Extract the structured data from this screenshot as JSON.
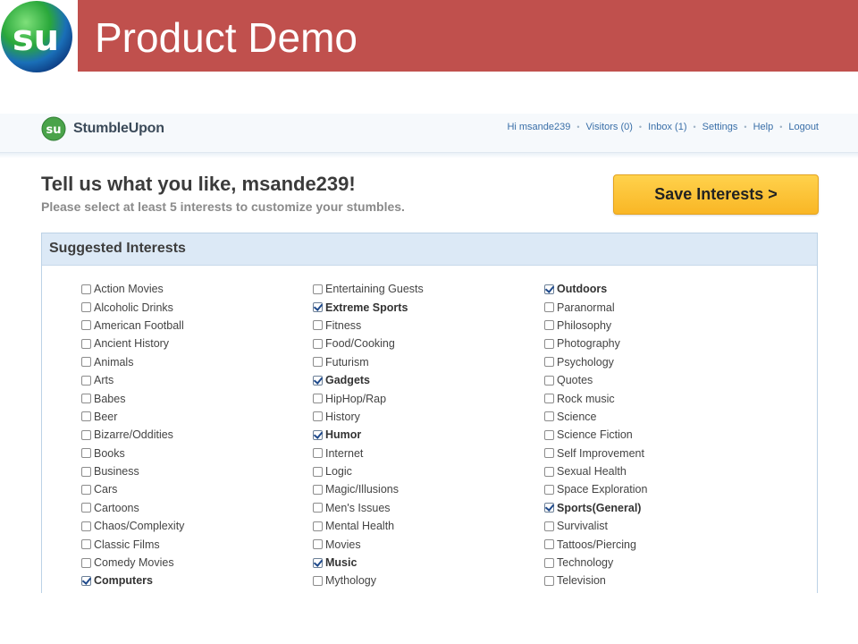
{
  "slide": {
    "title": "Product Demo"
  },
  "app": {
    "name": "StumbleUpon",
    "nav": [
      "Hi msande239",
      "Visitors (0)",
      "Inbox (1)",
      "Settings",
      "Help",
      "Logout"
    ]
  },
  "main": {
    "heading": "Tell us what you like, msande239!",
    "subheading": "Please select at least 5 interests to customize your stumbles.",
    "save_label": "Save Interests >"
  },
  "panel": {
    "title": "Suggested Interests",
    "columns": [
      [
        {
          "label": "Action Movies",
          "checked": false
        },
        {
          "label": "Alcoholic Drinks",
          "checked": false
        },
        {
          "label": "American Football",
          "checked": false
        },
        {
          "label": "Ancient History",
          "checked": false
        },
        {
          "label": "Animals",
          "checked": false
        },
        {
          "label": "Arts",
          "checked": false
        },
        {
          "label": "Babes",
          "checked": false
        },
        {
          "label": "Beer",
          "checked": false
        },
        {
          "label": "Bizarre/Oddities",
          "checked": false
        },
        {
          "label": "Books",
          "checked": false
        },
        {
          "label": "Business",
          "checked": false
        },
        {
          "label": "Cars",
          "checked": false
        },
        {
          "label": "Cartoons",
          "checked": false
        },
        {
          "label": "Chaos/Complexity",
          "checked": false
        },
        {
          "label": "Classic Films",
          "checked": false
        },
        {
          "label": "Comedy Movies",
          "checked": false
        },
        {
          "label": "Computers",
          "checked": true
        }
      ],
      [
        {
          "label": "Entertaining Guests",
          "checked": false
        },
        {
          "label": "Extreme Sports",
          "checked": true
        },
        {
          "label": "Fitness",
          "checked": false
        },
        {
          "label": "Food/Cooking",
          "checked": false
        },
        {
          "label": "Futurism",
          "checked": false
        },
        {
          "label": "Gadgets",
          "checked": true
        },
        {
          "label": "HipHop/Rap",
          "checked": false
        },
        {
          "label": "History",
          "checked": false
        },
        {
          "label": "Humor",
          "checked": true
        },
        {
          "label": "Internet",
          "checked": false
        },
        {
          "label": "Logic",
          "checked": false
        },
        {
          "label": "Magic/Illusions",
          "checked": false
        },
        {
          "label": "Men's Issues",
          "checked": false
        },
        {
          "label": "Mental Health",
          "checked": false
        },
        {
          "label": "Movies",
          "checked": false
        },
        {
          "label": "Music",
          "checked": true
        },
        {
          "label": "Mythology",
          "checked": false
        }
      ],
      [
        {
          "label": "Outdoors",
          "checked": true
        },
        {
          "label": "Paranormal",
          "checked": false
        },
        {
          "label": "Philosophy",
          "checked": false
        },
        {
          "label": "Photography",
          "checked": false
        },
        {
          "label": "Psychology",
          "checked": false
        },
        {
          "label": "Quotes",
          "checked": false
        },
        {
          "label": "Rock music",
          "checked": false
        },
        {
          "label": "Science",
          "checked": false
        },
        {
          "label": "Science Fiction",
          "checked": false
        },
        {
          "label": "Self Improvement",
          "checked": false
        },
        {
          "label": "Sexual Health",
          "checked": false
        },
        {
          "label": "Space Exploration",
          "checked": false
        },
        {
          "label": "Sports(General)",
          "checked": true
        },
        {
          "label": "Survivalist",
          "checked": false
        },
        {
          "label": "Tattoos/Piercing",
          "checked": false
        },
        {
          "label": "Technology",
          "checked": false
        },
        {
          "label": "Television",
          "checked": false
        }
      ]
    ]
  },
  "colors": {
    "slide_band": "#c0504d",
    "save_button": "#f9b625",
    "panel_header": "#dce9f6",
    "link": "#3a6fa8"
  }
}
